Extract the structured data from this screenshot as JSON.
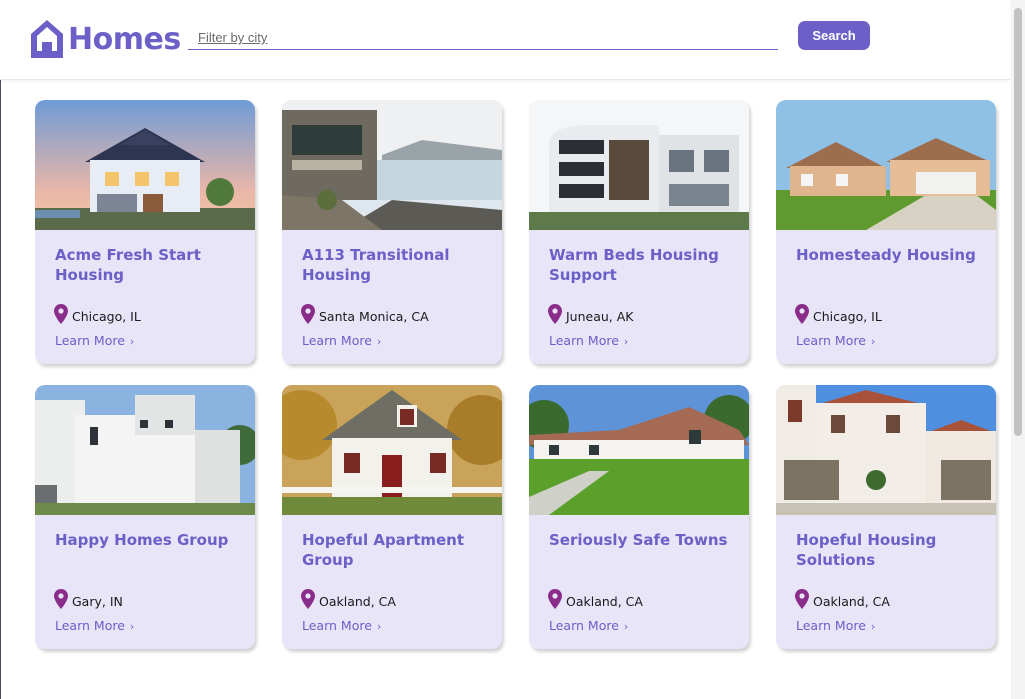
{
  "header": {
    "logo_text": "Homes",
    "search_placeholder": "Filter by city",
    "search_button": "Search",
    "brand_color": "#6c5fc7"
  },
  "listings": [
    {
      "title": "Acme Fresh Start Housing",
      "location": "Chicago, IL",
      "link": "Learn More",
      "photo": "blue-suburban-house-dusk"
    },
    {
      "title": "A113 Transitional Housing",
      "location": "Santa Monica, CA",
      "link": "Learn More",
      "photo": "stone-house-lakeside"
    },
    {
      "title": "Warm Beds Housing Support",
      "location": "Juneau, AK",
      "link": "Learn More",
      "photo": "modern-white-building"
    },
    {
      "title": "Homesteady Housing",
      "location": "Chicago, IL",
      "link": "Learn More",
      "photo": "tan-ranch-house"
    },
    {
      "title": "Happy Homes Group",
      "location": "Gary, IN",
      "link": "Learn More",
      "photo": "white-modern-house"
    },
    {
      "title": "Hopeful Apartment Group",
      "location": "Oakland, CA",
      "link": "Learn More",
      "photo": "white-cottage-autumn"
    },
    {
      "title": "Seriously Safe Towns",
      "location": "Oakland, CA",
      "link": "Learn More",
      "photo": "white-house-green-lawn"
    },
    {
      "title": "Hopeful Housing Solutions",
      "location": "Oakland, CA",
      "link": "Learn More",
      "photo": "white-villa-red-roof"
    }
  ]
}
